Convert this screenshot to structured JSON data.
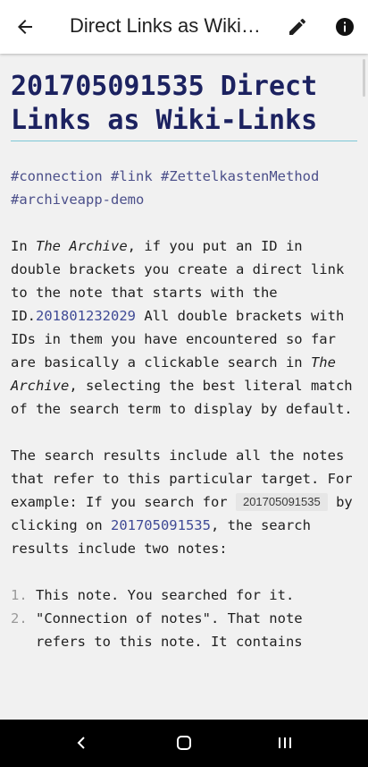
{
  "appbar": {
    "title": "Direct Links as Wiki-Links",
    "back_icon": "arrow-back-icon",
    "edit_icon": "pencil-icon",
    "info_icon": "info-icon"
  },
  "note": {
    "title": "201705091535 Direct Links as Wiki-Links",
    "tags": [
      "#connection",
      "#link",
      "#ZettelkastenMethod",
      "#archiveapp-demo"
    ],
    "para1": {
      "t1": "In ",
      "em1": "The Archive",
      "t2": ", if you put an ID in double brackets you create a direct link to the note that starts with the ID.",
      "link1": "201801232029",
      "t3": " All double brackets with IDs in them you have encountered so far are basically a clickable search in ",
      "em2": "The Archive",
      "t4": ", selecting the best literal match of the search term to display by default."
    },
    "para2": {
      "t1": "The search results include all the notes that refer to this particular target. For example: If you search for ",
      "code": "201705091535",
      "t2": " by clicking on ",
      "link": "201705091535",
      "t3": ", the search results include two notes:"
    },
    "list": [
      {
        "num": "1.",
        "text": "This note. You searched for it."
      },
      {
        "num": "2.",
        "text": "\"Connection of notes\". That note refers to this note. It contains"
      }
    ]
  },
  "colors": {
    "title": "#1c2260",
    "link": "#3f4a96",
    "underline": "#7dc7d6",
    "navbar": "#000000"
  },
  "navbar": {
    "back_icon": "nav-back-icon",
    "home_icon": "nav-home-icon",
    "recents_icon": "nav-recents-icon"
  }
}
